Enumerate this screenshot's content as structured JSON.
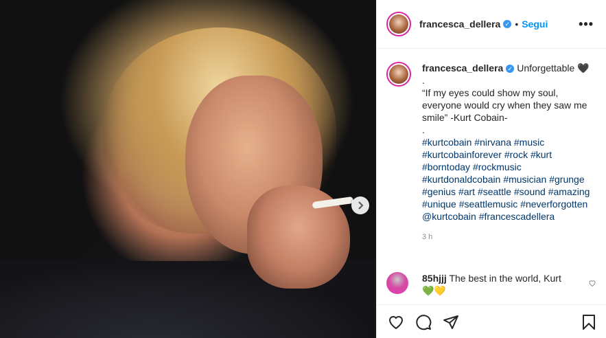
{
  "post": {
    "username": "francesca_dellera",
    "dot": "•",
    "follow_label": "Segui",
    "more_label": "•••"
  },
  "caption": {
    "username": "francesca_dellera",
    "headline": "Unforgettable 🖤",
    "line_dot1": ".",
    "quote": "“If my eyes could show my soul, everyone would cry when they saw me smile” -Kurt Cobain-",
    "line_dot2": ".",
    "hashtags": [
      "#kurtcobain",
      "#nirvana",
      "#music",
      "#kurtcobainforever",
      "#rock",
      "#kurt",
      "#borntoday",
      "#rockmusic",
      "#kurtdonaldcobain",
      "#musician",
      "#grunge",
      "#genius",
      "#art",
      "#seattle",
      "#sound",
      "#amazing",
      "#unique",
      "#seattlemusic",
      "#neverforgotten"
    ],
    "mention": "@kurtcobain",
    "last_tag": "#francescadellera",
    "time": "3 h"
  },
  "comment": {
    "username": "85hjjj",
    "text": "The best in the world, Kurt",
    "emojis": "💚💛"
  },
  "icons": {
    "verified": "verified-badge-icon",
    "next": "chevron-right-icon",
    "like": "heart-icon",
    "comment": "comment-bubble-icon",
    "share": "paper-plane-icon",
    "save": "bookmark-icon"
  },
  "colors": {
    "accent_blue": "#0095f6",
    "link": "#00376b",
    "verified": "#3897f0",
    "ring": "#d6249f"
  }
}
